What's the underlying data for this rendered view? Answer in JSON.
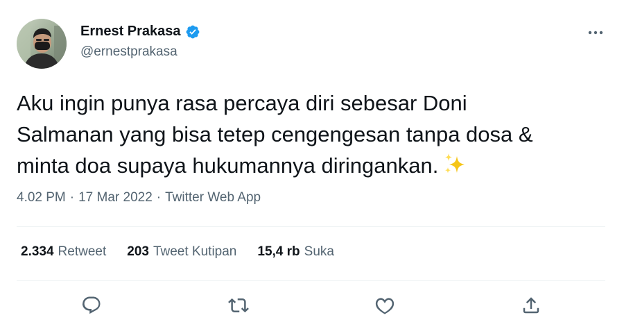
{
  "user": {
    "display_name": "Ernest Prakasa",
    "handle": "@ernestprakasa"
  },
  "tweet": {
    "line1": "Aku ingin punya rasa percaya diri sebesar Doni",
    "line2": "Salmanan yang bisa tetep cengengesan tanpa dosa &",
    "line3": "minta doa supaya hukumannya diringankan."
  },
  "meta": {
    "time": "4.02 PM",
    "sep1": "·",
    "date": "17 Mar 2022",
    "sep2": "·",
    "source": "Twitter Web App"
  },
  "stats": {
    "retweets_count": "2.334",
    "retweets_label": "Retweet",
    "quotes_count": "203",
    "quotes_label": "Tweet Kutipan",
    "likes_count": "15,4 rb",
    "likes_label": "Suka"
  },
  "icons": {
    "verified": "verified-badge-icon",
    "more": "more-dots-icon",
    "reply": "reply-bubble-icon",
    "retweet": "retweet-arrows-icon",
    "like": "heart-icon",
    "share": "share-upload-icon",
    "emoji": "sparkles-emoji"
  },
  "colors": {
    "text": "#0f1419",
    "secondary": "#536471",
    "verified": "#1d9bf0",
    "divider": "#eff3f4",
    "sparkle": "#f5c518"
  }
}
